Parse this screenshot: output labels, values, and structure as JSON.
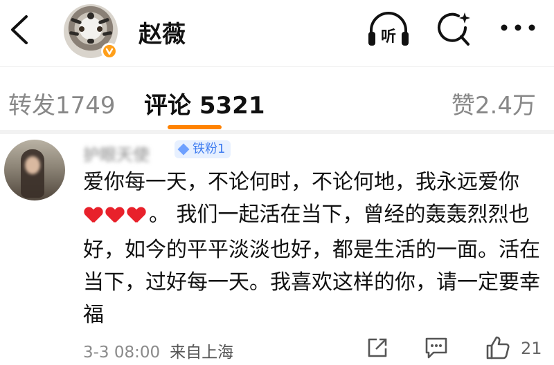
{
  "header": {
    "username": "赵薇",
    "listen_label": "听"
  },
  "tabs": [
    {
      "label": "转发",
      "count": "1749"
    },
    {
      "label": "评论",
      "count": "5321"
    },
    {
      "label": "赞",
      "count": "2.4万"
    }
  ],
  "comment": {
    "username": "护眼天使",
    "badge": "铁粉1",
    "text_part1": "爱你每一天，不论何时，不论何地，我永远爱你",
    "text_part2": "。 我们一起活在当下，曾经的轰轰烈烈也好，如今的平平淡淡也好，都是生活的一面。活在当下，过好每一天。我喜欢这样的你，请一定要幸福",
    "time": "3-3 08:00",
    "location": "来自上海",
    "like_count": "21"
  },
  "colors": {
    "accent": "#ff8200",
    "heart": "#e8212b",
    "badge_text": "#3f7cf0"
  }
}
